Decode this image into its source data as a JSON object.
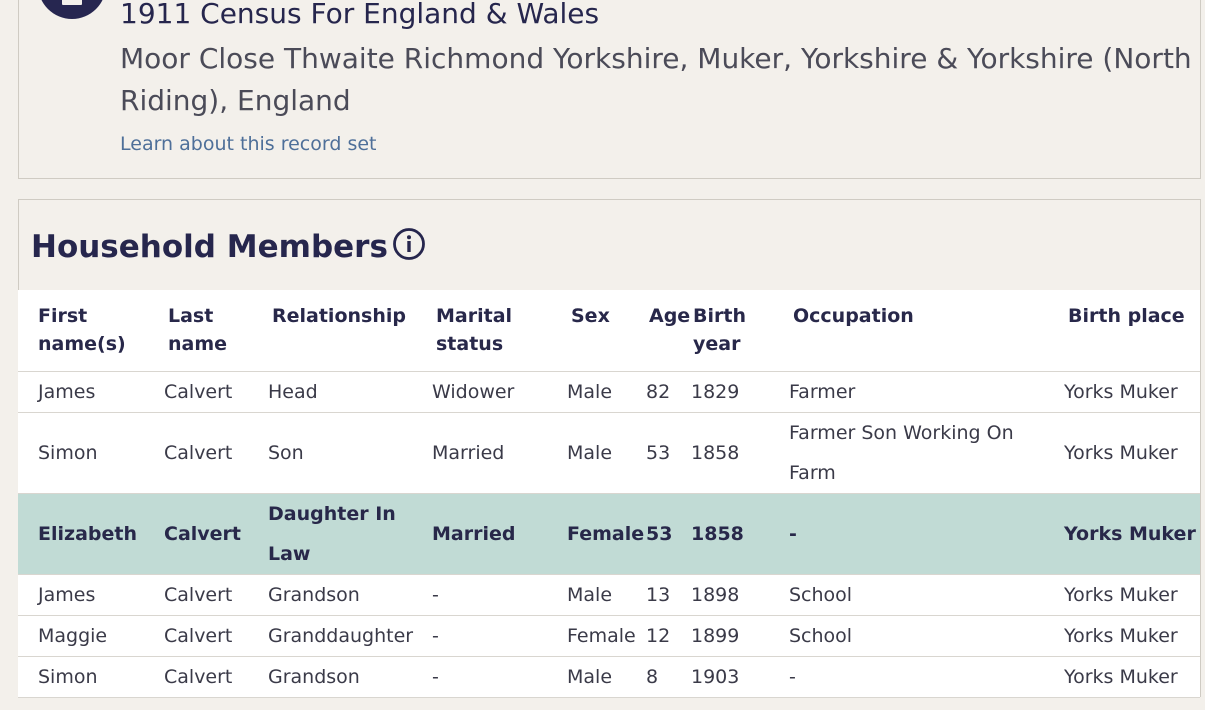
{
  "record": {
    "title": "1911 Census For England & Wales",
    "location": "Moor Close Thwaite Richmond Yorkshire, Muker, Yorkshire & Yorkshire (North Riding), England",
    "learn_link": "Learn about this record set"
  },
  "household": {
    "title": "Household Members",
    "columns": [
      "First name(s)",
      "Last name",
      "Relationship",
      "Marital status",
      "Sex",
      "Age",
      "Birth year",
      "Occupation",
      "Birth place"
    ],
    "rows": [
      {
        "first": "James",
        "last": "Calvert",
        "relationship": "Head",
        "marital": "Widower",
        "sex": "Male",
        "age": "82",
        "birth_year": "1829",
        "occupation": "Farmer",
        "birth_place": "Yorks Muker"
      },
      {
        "first": "Simon",
        "last": "Calvert",
        "relationship": "Son",
        "marital": "Married",
        "sex": "Male",
        "age": "53",
        "birth_year": "1858",
        "occupation": "Farmer Son Working On Farm",
        "birth_place": "Yorks Muker"
      },
      {
        "first": "Elizabeth",
        "last": "Calvert",
        "relationship": "Daughter In Law",
        "marital": "Married",
        "sex": "Female",
        "age": "53",
        "birth_year": "1858",
        "occupation": "-",
        "birth_place": "Yorks Muker"
      },
      {
        "first": "James",
        "last": "Calvert",
        "relationship": "Grandson",
        "marital": "-",
        "sex": "Male",
        "age": "13",
        "birth_year": "1898",
        "occupation": "School",
        "birth_place": "Yorks Muker"
      },
      {
        "first": "Maggie",
        "last": "Calvert",
        "relationship": "Granddaughter",
        "marital": "-",
        "sex": "Female",
        "age": "12",
        "birth_year": "1899",
        "occupation": "School",
        "birth_place": "Yorks Muker"
      },
      {
        "first": "Simon",
        "last": "Calvert",
        "relationship": "Grandson",
        "marital": "-",
        "sex": "Male",
        "age": "8",
        "birth_year": "1903",
        "occupation": "-",
        "birth_place": "Yorks Muker"
      }
    ]
  },
  "colors": {
    "background": "#f3f0eb",
    "heading": "#26264d",
    "link": "#4e6f99",
    "highlight_row": "#c1dbd5"
  },
  "icons": {
    "record": "record-set-icon",
    "info": "info-icon"
  }
}
